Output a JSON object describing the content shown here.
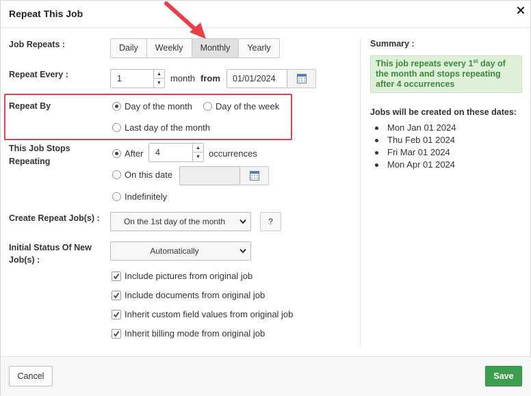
{
  "dialog": {
    "title": "Repeat This Job",
    "close_icon": "close-icon"
  },
  "job_repeats": {
    "label": "Job Repeats :",
    "options": [
      "Daily",
      "Weekly",
      "Monthly",
      "Yearly"
    ],
    "selected": "Monthly"
  },
  "repeat_every": {
    "label": "Repeat Every :",
    "value": "1",
    "unit_text": "month",
    "from_text": "from",
    "from_date": "01/01/2024",
    "calendar_icon": "calendar-icon"
  },
  "repeat_by": {
    "label": "Repeat By",
    "options": [
      "Day of the month",
      "Day of the week",
      "Last day of the month"
    ],
    "selected": "Day of the month"
  },
  "stops_repeating": {
    "label_line1": "This Job Stops",
    "label_line2": "Repeating",
    "after_label": "After",
    "after_value": "4",
    "occurrences_text": "occurrences",
    "on_date_label": "On this date",
    "on_date_value": "",
    "indefinitely_label": "Indefinitely",
    "selected": "After"
  },
  "create_repeat": {
    "label": "Create Repeat Job(s) :",
    "selected": "On the 1st day of the month",
    "help_label": "?"
  },
  "initial_status": {
    "label_line1": "Initial Status Of New",
    "label_line2": "Job(s) :",
    "selected": "Automatically"
  },
  "checkboxes": [
    {
      "label": "Include pictures from original job",
      "checked": true
    },
    {
      "label": "Include documents from original job",
      "checked": true
    },
    {
      "label": "Inherit custom field values from original job",
      "checked": true
    },
    {
      "label": "Inherit billing mode from original job",
      "checked": true
    }
  ],
  "summary": {
    "title": "Summary :",
    "text_part1": "This job repeats every 1",
    "text_sup": "st",
    "text_part2": " day of the month and stops repeating after 4 occurrences",
    "dates_title": "Jobs will be created on these dates:",
    "dates": [
      "Mon Jan 01 2024",
      "Thu Feb 01 2024",
      "Fri Mar 01 2024",
      "Mon Apr 01 2024"
    ]
  },
  "footer": {
    "cancel_label": "Cancel",
    "save_label": "Save"
  },
  "colors": {
    "accent_green": "#3c9f4e",
    "summary_bg": "#dff0d8",
    "summary_text": "#3c8a3c",
    "highlight_red": "#e8404a"
  }
}
